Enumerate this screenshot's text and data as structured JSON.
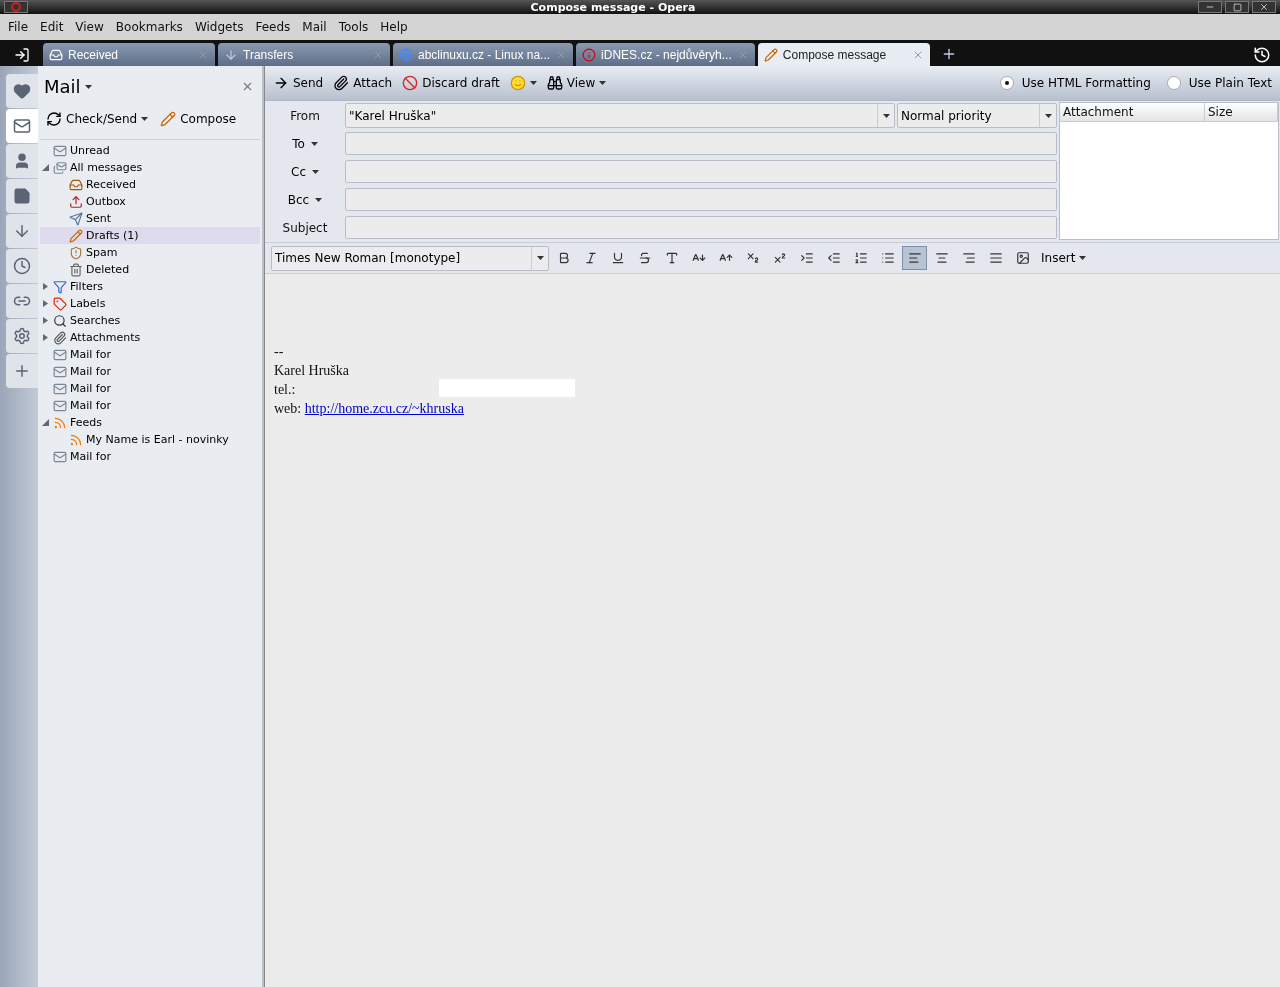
{
  "window": {
    "title": "Compose message - Opera"
  },
  "menu": [
    "File",
    "Edit",
    "View",
    "Bookmarks",
    "Widgets",
    "Feeds",
    "Mail",
    "Tools",
    "Help"
  ],
  "tabs": [
    {
      "label": "Received",
      "kind": "inbox",
      "selected": false
    },
    {
      "label": "Transfers",
      "kind": "download",
      "selected": false
    },
    {
      "label": "abclinuxu.cz - Linux na...",
      "kind": "site",
      "selected": false
    },
    {
      "label": "iDNES.cz - nejdůvěryh...",
      "kind": "info",
      "selected": false
    },
    {
      "label": "Compose message",
      "kind": "pencil",
      "selected": true
    }
  ],
  "side_rail": [
    {
      "kind": "heart",
      "selected": false
    },
    {
      "kind": "mail",
      "selected": true
    },
    {
      "kind": "person",
      "selected": false
    },
    {
      "kind": "note",
      "selected": false
    },
    {
      "kind": "download",
      "selected": false
    },
    {
      "kind": "clock",
      "selected": false
    },
    {
      "kind": "link",
      "selected": false
    },
    {
      "kind": "gear",
      "selected": false
    },
    {
      "kind": "plus",
      "selected": false
    }
  ],
  "mail_panel": {
    "title": "Mail",
    "buttons": [
      "Check/Send",
      "Compose"
    ],
    "tree": [
      {
        "label": "Unread",
        "kind": "mail",
        "selected": false
      },
      {
        "label": "All messages",
        "kind": "allmail",
        "selected": false,
        "expanded": true,
        "children": [
          {
            "label": "Received",
            "kind": "inbox",
            "selected": false
          },
          {
            "label": "Outbox",
            "kind": "outbox",
            "selected": false
          },
          {
            "label": "Sent",
            "kind": "sent",
            "selected": false
          },
          {
            "label": "Drafts (1)",
            "kind": "pencil",
            "selected": true
          },
          {
            "label": "Spam",
            "kind": "spam",
            "selected": false
          },
          {
            "label": "Deleted",
            "kind": "trash",
            "selected": false
          }
        ]
      },
      {
        "label": "Filters",
        "kind": "filter",
        "selected": false,
        "expanded": false
      },
      {
        "label": "Labels",
        "kind": "label",
        "selected": false,
        "expanded": false
      },
      {
        "label": "Searches",
        "kind": "search",
        "selected": false,
        "expanded": false
      },
      {
        "label": "Attachments",
        "kind": "clip",
        "selected": false,
        "expanded": false
      },
      {
        "label": "Mail for",
        "kind": "mail",
        "selected": false
      },
      {
        "label": "Mail for",
        "kind": "mail",
        "selected": false
      },
      {
        "label": "Mail for",
        "kind": "mail",
        "selected": false
      },
      {
        "label": "Mail for",
        "kind": "mail",
        "selected": false
      },
      {
        "label": "Feeds",
        "kind": "feed",
        "selected": false,
        "expanded": true,
        "children": [
          {
            "label": "My Name is Earl - novinky",
            "kind": "feed",
            "selected": false
          }
        ]
      },
      {
        "label": "Mail for",
        "kind": "mail",
        "selected": false
      }
    ]
  },
  "compose_toolbar": {
    "buttons": [
      {
        "label": "Send",
        "kind": "send"
      },
      {
        "label": "Attach",
        "kind": "clip"
      },
      {
        "label": "Discard draft",
        "kind": "discard"
      },
      {
        "kind": "smiley"
      },
      {
        "label": "View",
        "kind": "view"
      }
    ],
    "format_options": [
      {
        "label": "Use HTML Formatting",
        "selected": true
      },
      {
        "label": "Use Plain Text",
        "selected": false
      }
    ]
  },
  "headers": {
    "from_label": "From",
    "from_value": "\"Karel Hruška\"",
    "priority": "Normal priority",
    "fields": [
      {
        "label": "To",
        "dropdown": true
      },
      {
        "label": "Cc",
        "dropdown": true
      },
      {
        "label": "Bcc",
        "dropdown": true
      },
      {
        "label": "Subject",
        "dropdown": false
      }
    ],
    "attachment_columns": [
      "Attachment",
      "Size"
    ]
  },
  "format_bar": {
    "font": "Times New Roman [monotype]",
    "tools": [
      {
        "kind": "bold"
      },
      {
        "kind": "italic"
      },
      {
        "kind": "underline"
      },
      {
        "kind": "strike"
      },
      {
        "kind": "plain"
      },
      {
        "kind": "smaller"
      },
      {
        "kind": "larger"
      },
      {
        "kind": "subscript"
      },
      {
        "kind": "superscript"
      },
      {
        "kind": "indent"
      },
      {
        "kind": "outdent"
      },
      {
        "kind": "numbered"
      },
      {
        "kind": "bullets"
      }
    ],
    "align": [
      {
        "kind": "left",
        "selected": true
      },
      {
        "kind": "center",
        "selected": false
      },
      {
        "kind": "right",
        "selected": false
      },
      {
        "kind": "justify",
        "selected": false
      }
    ],
    "insert": "Insert"
  },
  "body": {
    "lines": [
      "--",
      "Karel Hruška",
      "tel.:"
    ],
    "web_label": "web:",
    "link": "http://home.zcu.cz/~khruska"
  }
}
